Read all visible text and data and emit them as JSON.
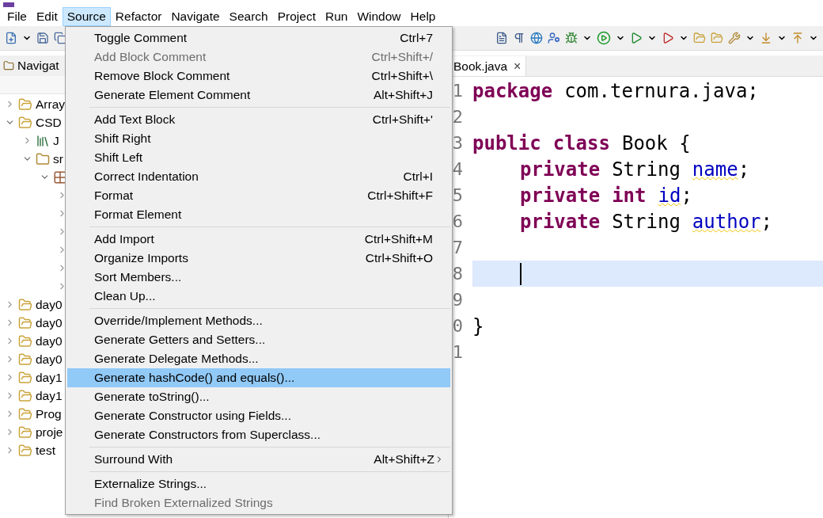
{
  "menu_bar": [
    {
      "label": "File",
      "selected": false
    },
    {
      "label": "Edit",
      "selected": false
    },
    {
      "label": "Source",
      "selected": true
    },
    {
      "label": "Refactor",
      "selected": false
    },
    {
      "label": "Navigate",
      "selected": false
    },
    {
      "label": "Search",
      "selected": false
    },
    {
      "label": "Project",
      "selected": false
    },
    {
      "label": "Run",
      "selected": false
    },
    {
      "label": "Window",
      "selected": false
    },
    {
      "label": "Help",
      "selected": false
    }
  ],
  "source_menu": [
    [
      {
        "label": "Toggle Comment",
        "shortcut": "Ctrl+7",
        "disabled": false,
        "selected": false,
        "submenu": false
      },
      {
        "label": "Add Block Comment",
        "shortcut": "Ctrl+Shift+/",
        "disabled": true,
        "selected": false,
        "submenu": false
      },
      {
        "label": "Remove Block Comment",
        "shortcut": "Ctrl+Shift+\\",
        "disabled": false,
        "selected": false,
        "submenu": false
      },
      {
        "label": "Generate Element Comment",
        "shortcut": "Alt+Shift+J",
        "disabled": false,
        "selected": false,
        "submenu": false
      }
    ],
    [
      {
        "label": "Add Text Block",
        "shortcut": "Ctrl+Shift+'",
        "disabled": false,
        "selected": false,
        "submenu": false
      },
      {
        "label": "Shift Right",
        "disabled": false,
        "selected": false,
        "submenu": false
      },
      {
        "label": "Shift Left",
        "disabled": false,
        "selected": false,
        "submenu": false
      },
      {
        "label": "Correct Indentation",
        "shortcut": "Ctrl+I",
        "disabled": false,
        "selected": false,
        "submenu": false
      },
      {
        "label": "Format",
        "shortcut": "Ctrl+Shift+F",
        "disabled": false,
        "selected": false,
        "submenu": false
      },
      {
        "label": "Format Element",
        "disabled": false,
        "selected": false,
        "submenu": false
      }
    ],
    [
      {
        "label": "Add Import",
        "shortcut": "Ctrl+Shift+M",
        "disabled": false,
        "selected": false,
        "submenu": false
      },
      {
        "label": "Organize Imports",
        "shortcut": "Ctrl+Shift+O",
        "disabled": false,
        "selected": false,
        "submenu": false
      },
      {
        "label": "Sort Members...",
        "disabled": false,
        "selected": false,
        "submenu": false
      },
      {
        "label": "Clean Up...",
        "disabled": false,
        "selected": false,
        "submenu": false
      }
    ],
    [
      {
        "label": "Override/Implement Methods...",
        "disabled": false,
        "selected": false,
        "submenu": false
      },
      {
        "label": "Generate Getters and Setters...",
        "disabled": false,
        "selected": false,
        "submenu": false
      },
      {
        "label": "Generate Delegate Methods...",
        "disabled": false,
        "selected": false,
        "submenu": false
      },
      {
        "label": "Generate hashCode() and equals()...",
        "disabled": false,
        "selected": true,
        "submenu": false
      },
      {
        "label": "Generate toString()...",
        "disabled": false,
        "selected": false,
        "submenu": false
      },
      {
        "label": "Generate Constructor using Fields...",
        "disabled": false,
        "selected": false,
        "submenu": false
      },
      {
        "label": "Generate Constructors from Superclass...",
        "disabled": false,
        "selected": false,
        "submenu": false
      }
    ],
    [
      {
        "label": "Surround With",
        "shortcut": "Alt+Shift+Z",
        "disabled": false,
        "selected": false,
        "submenu": true
      }
    ],
    [
      {
        "label": "Externalize Strings...",
        "disabled": false,
        "selected": false,
        "submenu": false
      },
      {
        "label": "Find Broken Externalized Strings",
        "disabled": true,
        "selected": false,
        "submenu": false
      }
    ]
  ],
  "navigator": {
    "tab": "Navigat",
    "tree": [
      {
        "label": "Array",
        "kind": "project",
        "expanded": false
      },
      {
        "label": "CSD",
        "kind": "project",
        "expanded": true,
        "children": [
          {
            "label": "J",
            "kind": "library",
            "expanded": false
          },
          {
            "label": "sr",
            "kind": "source-folder",
            "expanded": true,
            "children": [
              {
                "kind": "package",
                "expanded": true,
                "children": [
                  {
                    "expanded": false
                  },
                  {
                    "expanded": false
                  },
                  {
                    "expanded": false
                  },
                  {
                    "expanded": false
                  },
                  {
                    "expanded": false
                  },
                  {
                    "expanded": false
                  }
                ]
              }
            ]
          }
        ]
      },
      {
        "label": "day0",
        "kind": "project",
        "expanded": false
      },
      {
        "label": "day0",
        "kind": "project",
        "expanded": false
      },
      {
        "label": "day0",
        "kind": "project",
        "expanded": false
      },
      {
        "label": "day0",
        "kind": "project",
        "expanded": false
      },
      {
        "label": "day1",
        "kind": "project",
        "expanded": false
      },
      {
        "label": "day1",
        "kind": "project",
        "expanded": false
      },
      {
        "label": "Prog",
        "kind": "project",
        "expanded": false
      },
      {
        "label": "proje",
        "kind": "project",
        "expanded": false
      },
      {
        "label": "test",
        "kind": "project",
        "expanded": false
      }
    ]
  },
  "editor": {
    "tab": {
      "label": "Book.java",
      "close": "×"
    },
    "lines": [
      {
        "number": "1",
        "indented": false,
        "current": false,
        "tokens": [
          {
            "text": "package",
            "kind": "keyword"
          },
          {
            "text": "com.ternura.java;",
            "kind": "plain"
          }
        ]
      },
      {
        "number": "2",
        "current": false
      },
      {
        "number": "3",
        "indented": false,
        "current": false,
        "tokens": [
          {
            "text": "public",
            "kind": "keyword"
          },
          {
            "text": "class",
            "kind": "keyword"
          },
          {
            "text": "Book {",
            "kind": "plain"
          }
        ]
      },
      {
        "number": "4",
        "indented": true,
        "current": false,
        "tokens": [
          {
            "text": "private",
            "kind": "keyword"
          },
          {
            "text": "String",
            "kind": "plain"
          },
          {
            "text": "name",
            "kind": "field",
            "warning": true
          },
          {
            "text": ";",
            "kind": "plain",
            "joined": true
          }
        ]
      },
      {
        "number": "5",
        "indented": true,
        "current": false,
        "tokens": [
          {
            "text": "private",
            "kind": "keyword"
          },
          {
            "text": "int",
            "kind": "keyword"
          },
          {
            "text": "id",
            "kind": "field",
            "warning": true
          },
          {
            "text": ";",
            "kind": "plain",
            "joined": true
          }
        ]
      },
      {
        "number": "6",
        "indented": true,
        "current": false,
        "tokens": [
          {
            "text": "private",
            "kind": "keyword"
          },
          {
            "text": "String",
            "kind": "plain"
          },
          {
            "text": "author",
            "kind": "field",
            "warning": true
          },
          {
            "text": ";",
            "kind": "plain",
            "joined": true
          }
        ]
      },
      {
        "number": "7",
        "current": false
      },
      {
        "number": "8",
        "indented": true,
        "current": true
      },
      {
        "number": "9",
        "current": false
      },
      {
        "number": "0",
        "indented": false,
        "current": false,
        "tokens": [
          {
            "text": "}",
            "kind": "plain"
          }
        ]
      },
      {
        "number": "1",
        "current": false
      }
    ]
  }
}
